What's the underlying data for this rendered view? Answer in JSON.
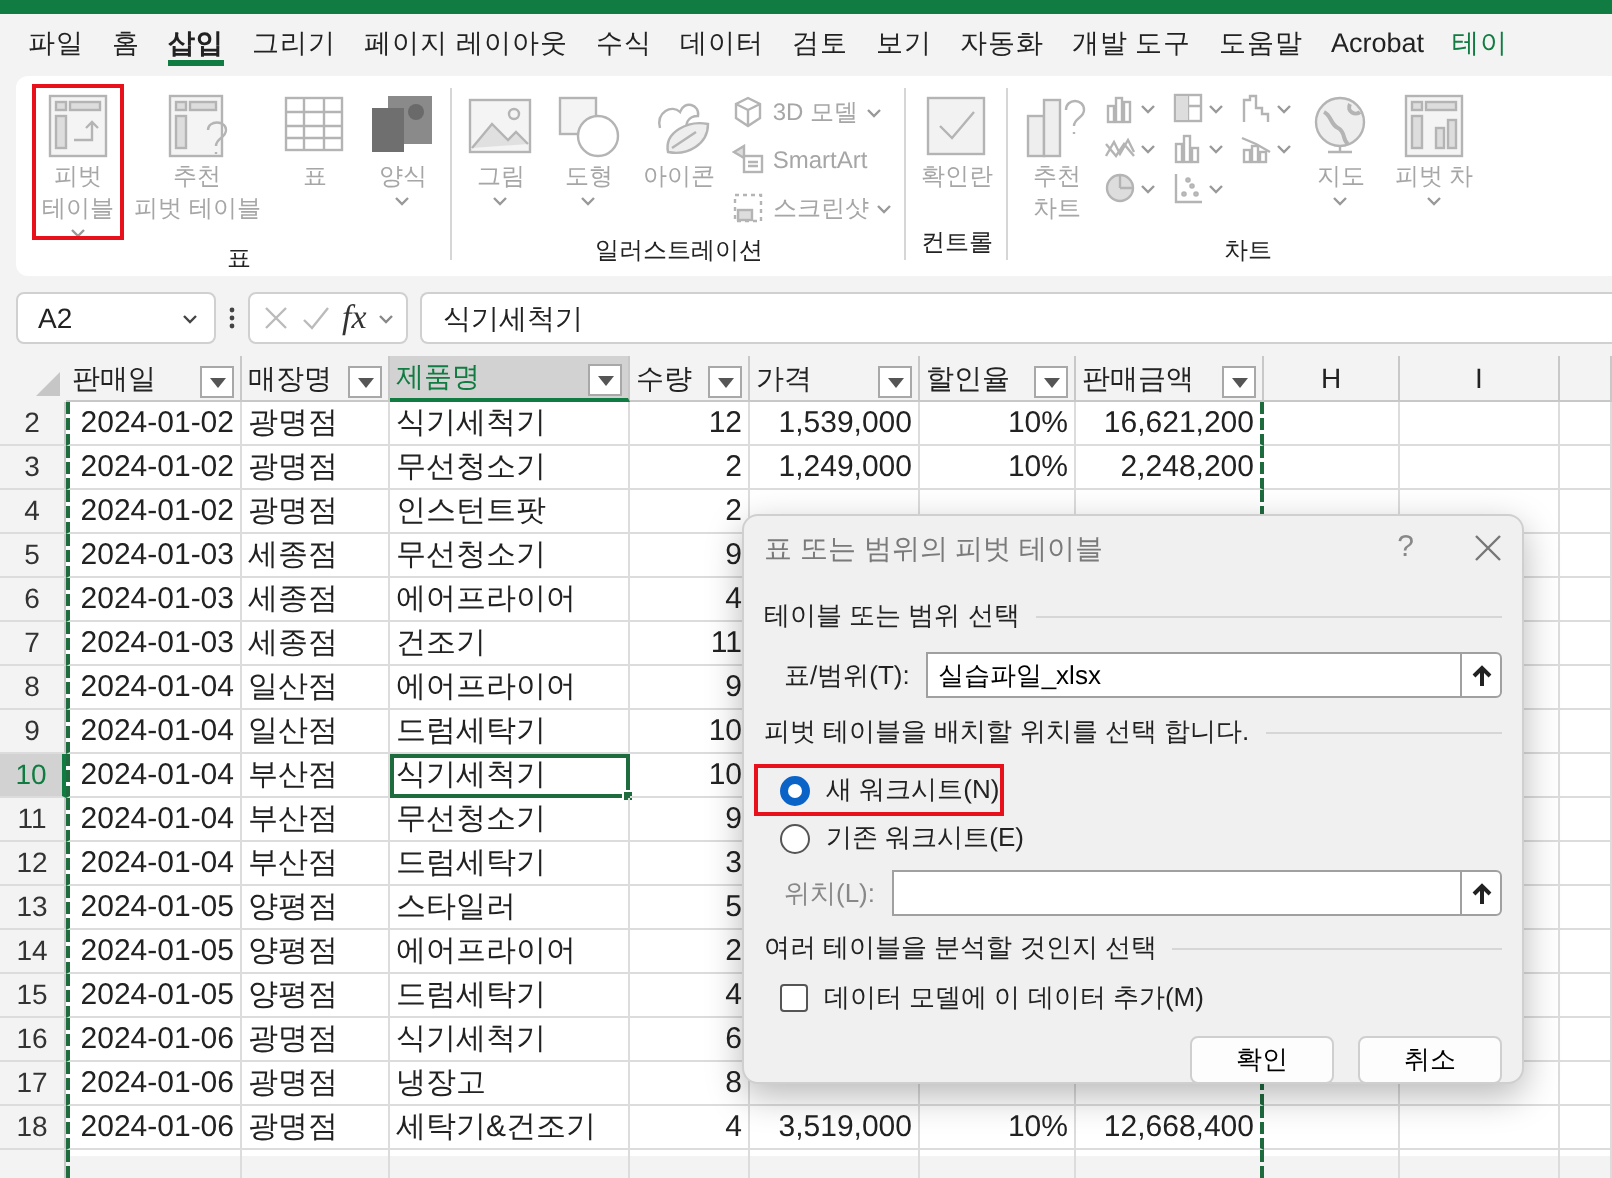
{
  "ribbon_tabs": [
    {
      "label": "파일",
      "selected": false,
      "kind": "standard"
    },
    {
      "label": "홈",
      "selected": false,
      "kind": "standard"
    },
    {
      "label": "삽입",
      "selected": true,
      "kind": "standard"
    },
    {
      "label": "그리기",
      "selected": false,
      "kind": "standard"
    },
    {
      "label": "페이지 레이아웃",
      "selected": false,
      "kind": "standard"
    },
    {
      "label": "수식",
      "selected": false,
      "kind": "standard"
    },
    {
      "label": "데이터",
      "selected": false,
      "kind": "standard"
    },
    {
      "label": "검토",
      "selected": false,
      "kind": "standard"
    },
    {
      "label": "보기",
      "selected": false,
      "kind": "standard"
    },
    {
      "label": "자동화",
      "selected": false,
      "kind": "standard"
    },
    {
      "label": "개발 도구",
      "selected": false,
      "kind": "standard"
    },
    {
      "label": "도움말",
      "selected": false,
      "kind": "standard"
    },
    {
      "label": "Acrobat",
      "selected": false,
      "kind": "standard"
    },
    {
      "label": "테이",
      "selected": false,
      "kind": "contextual"
    }
  ],
  "ribbon": {
    "disabled": true,
    "groups": [
      {
        "label": "표",
        "items": [
          {
            "kind": "large",
            "label": "피벗\n테이블",
            "dropdown": true,
            "highlighted": true
          },
          {
            "kind": "large",
            "label": "추천\n피벗 테이블",
            "dropdown": false,
            "highlighted": false
          },
          {
            "kind": "large",
            "label": "표",
            "dropdown": false,
            "highlighted": false
          },
          {
            "kind": "large",
            "label": "양식",
            "dropdown": true,
            "highlighted": false
          }
        ]
      },
      {
        "label": "일러스트레이션",
        "items": [
          {
            "kind": "large",
            "label": "그림",
            "dropdown": true,
            "highlighted": false
          },
          {
            "kind": "large",
            "label": "도형",
            "dropdown": true,
            "highlighted": false
          },
          {
            "kind": "large",
            "label": "아이콘",
            "dropdown": false,
            "highlighted": false
          },
          {
            "kind": "small",
            "label": "3D 모델",
            "dropdown": true,
            "highlighted": false
          },
          {
            "kind": "small",
            "label": "SmartArt",
            "dropdown": false,
            "highlighted": false
          },
          {
            "kind": "small",
            "label": "스크린샷",
            "dropdown": true,
            "highlighted": false
          }
        ]
      },
      {
        "label": "컨트롤",
        "items": [
          {
            "kind": "large",
            "label": "확인란",
            "dropdown": false,
            "highlighted": false
          }
        ]
      },
      {
        "label": "차트",
        "items": [
          {
            "kind": "large",
            "label": "추천\n차트",
            "dropdown": false,
            "highlighted": false
          },
          {
            "kind": "gallery",
            "dropdown": true,
            "highlighted": false
          },
          {
            "kind": "large",
            "label": "지도",
            "dropdown": true,
            "highlighted": false
          },
          {
            "kind": "large",
            "label": "피벗 차",
            "dropdown": true,
            "highlighted": false
          }
        ]
      }
    ]
  },
  "formula_bar": {
    "name_box": "A2",
    "function_label": "fx",
    "formula": "식기세척기"
  },
  "sheet": {
    "columns": [
      {
        "label": "판매일",
        "filter": true,
        "selected": false
      },
      {
        "label": "매장명",
        "filter": true,
        "selected": false
      },
      {
        "label": "제품명",
        "filter": true,
        "selected": true
      },
      {
        "label": "수량",
        "filter": true,
        "selected": false
      },
      {
        "label": "가격",
        "filter": true,
        "selected": false
      },
      {
        "label": "할인율",
        "filter": true,
        "selected": false
      },
      {
        "label": "판매금액",
        "filter": true,
        "selected": false
      },
      {
        "label": "H",
        "filter": false,
        "selected": false
      },
      {
        "label": "I",
        "filter": false,
        "selected": false
      }
    ],
    "rows": [
      {
        "number": "2",
        "selected": false,
        "cells": [
          "2024-01-02",
          "광명점",
          "식기세척기",
          "12",
          "1,539,000",
          "10%",
          "16,621,200"
        ]
      },
      {
        "number": "3",
        "selected": false,
        "cells": [
          "2024-01-02",
          "광명점",
          "무선청소기",
          "2",
          "1,249,000",
          "10%",
          "2,248,200"
        ]
      },
      {
        "number": "4",
        "selected": false,
        "cells": [
          "2024-01-02",
          "광명점",
          "인스턴트팟",
          "2",
          null,
          null,
          null
        ]
      },
      {
        "number": "5",
        "selected": false,
        "cells": [
          "2024-01-03",
          "세종점",
          "무선청소기",
          "9",
          null,
          null,
          null
        ]
      },
      {
        "number": "6",
        "selected": false,
        "cells": [
          "2024-01-03",
          "세종점",
          "에어프라이어",
          "4",
          null,
          null,
          null
        ]
      },
      {
        "number": "7",
        "selected": false,
        "cells": [
          "2024-01-03",
          "세종점",
          "건조기",
          "11",
          null,
          null,
          null
        ]
      },
      {
        "number": "8",
        "selected": false,
        "cells": [
          "2024-01-04",
          "일산점",
          "에어프라이어",
          "9",
          null,
          null,
          null
        ]
      },
      {
        "number": "9",
        "selected": false,
        "cells": [
          "2024-01-04",
          "일산점",
          "드럼세탁기",
          "10",
          null,
          null,
          null
        ]
      },
      {
        "number": "10",
        "selected": true,
        "cells": [
          "2024-01-04",
          "부산점",
          "식기세척기",
          "10",
          null,
          null,
          null
        ]
      },
      {
        "number": "11",
        "selected": false,
        "cells": [
          "2024-01-04",
          "부산점",
          "무선청소기",
          "9",
          null,
          null,
          null
        ]
      },
      {
        "number": "12",
        "selected": false,
        "cells": [
          "2024-01-04",
          "부산점",
          "드럼세탁기",
          "3",
          null,
          null,
          null
        ]
      },
      {
        "number": "13",
        "selected": false,
        "cells": [
          "2024-01-05",
          "양평점",
          "스타일러",
          "5",
          null,
          null,
          null
        ]
      },
      {
        "number": "14",
        "selected": false,
        "cells": [
          "2024-01-05",
          "양평점",
          "에어프라이어",
          "2",
          null,
          null,
          null
        ]
      },
      {
        "number": "15",
        "selected": false,
        "cells": [
          "2024-01-05",
          "양평점",
          "드럼세탁기",
          "4",
          null,
          null,
          null
        ]
      },
      {
        "number": "16",
        "selected": false,
        "cells": [
          "2024-01-06",
          "광명점",
          "식기세척기",
          "6",
          null,
          null,
          null
        ]
      },
      {
        "number": "17",
        "selected": false,
        "cells": [
          "2024-01-06",
          "광명점",
          "냉장고",
          "8",
          null,
          null,
          null
        ]
      },
      {
        "number": "18",
        "selected": false,
        "cells": [
          "2024-01-06",
          "광명점",
          "세탁기&건조기",
          "4",
          "3,519,000",
          "10%",
          "12,668,400"
        ]
      }
    ]
  },
  "dialog": {
    "title": "표 또는 범위의 피벗 테이블",
    "help_label": "?",
    "section_source": "테이블 또는 범위 선택",
    "range_field": {
      "label": "표/범위(T):",
      "value": "실습파일_xlsx"
    },
    "section_placement": "피벗 테이블을 배치할 위치를 선택 합니다.",
    "placement_options": [
      {
        "label": "새 워크시트(N)",
        "selected": true,
        "highlighted": true
      },
      {
        "label": "기존 워크시트(E)",
        "selected": false,
        "highlighted": false
      }
    ],
    "location_field": {
      "label": "위치(L):",
      "disabled": true
    },
    "section_multiple": "여러 테이블을 분석할 것인지 선택",
    "data_model_checkbox": {
      "label": "데이터 모델에 이 데이터 추가(M)",
      "checked": false
    },
    "buttons": [
      "확인",
      "취소"
    ]
  }
}
